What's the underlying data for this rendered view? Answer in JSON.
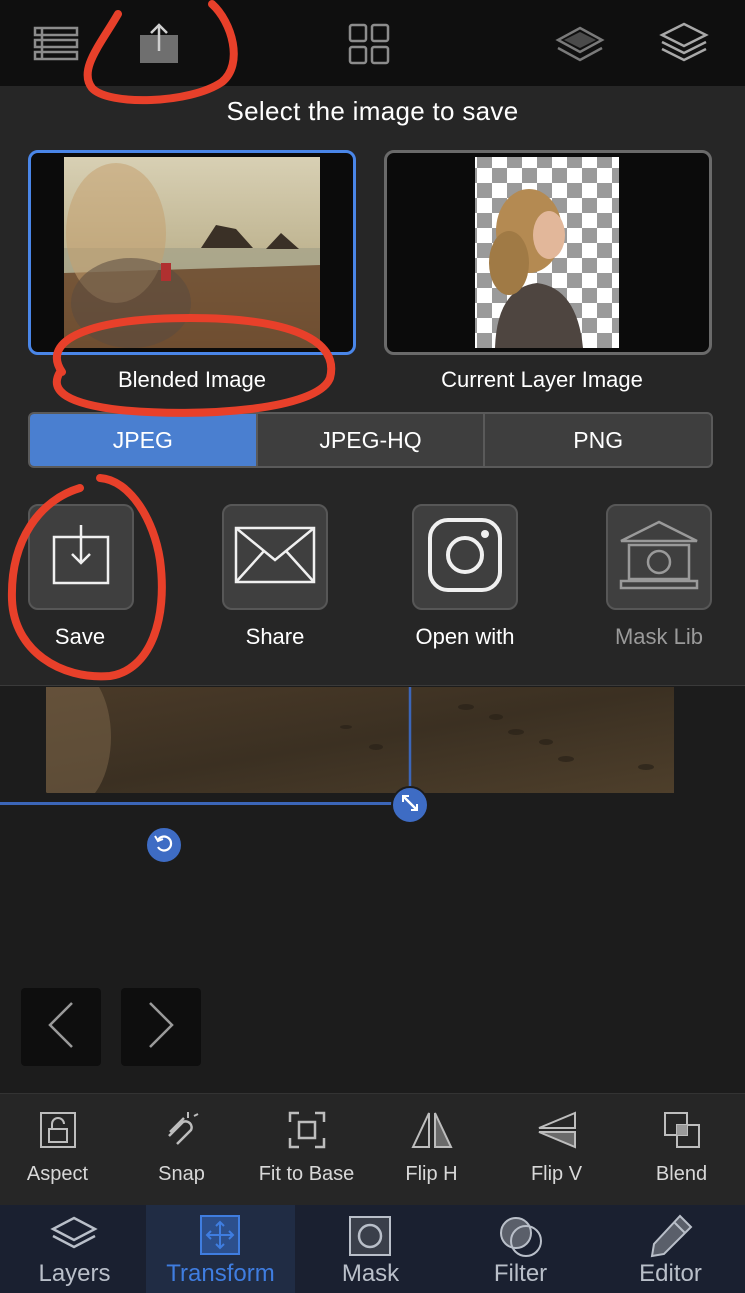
{
  "toolbar": {
    "icons": [
      "list-icon",
      "export-icon",
      "grid-icon",
      "layer-single-icon",
      "layers-stack-icon"
    ]
  },
  "save_panel": {
    "title": "Select the image to save",
    "options": [
      {
        "label": "Blended Image",
        "selected": true
      },
      {
        "label": "Current Layer Image",
        "selected": false
      }
    ],
    "formats": [
      {
        "label": "JPEG",
        "active": true
      },
      {
        "label": "JPEG-HQ",
        "active": false
      },
      {
        "label": "PNG",
        "active": false
      }
    ],
    "actions": [
      {
        "label": "Save",
        "icon": "save-download-icon",
        "enabled": true
      },
      {
        "label": "Share",
        "icon": "envelope-icon",
        "enabled": true
      },
      {
        "label": "Open with",
        "icon": "instagram-icon",
        "enabled": true
      },
      {
        "label": "Mask Lib",
        "icon": "mask-library-icon",
        "enabled": false
      }
    ]
  },
  "tools": [
    {
      "label": "Aspect",
      "icon": "aspect-lock-icon"
    },
    {
      "label": "Snap",
      "icon": "magnet-icon"
    },
    {
      "label": "Fit to Base",
      "icon": "fit-frame-icon"
    },
    {
      "label": "Flip H",
      "icon": "flip-horizontal-icon"
    },
    {
      "label": "Flip V",
      "icon": "flip-vertical-icon"
    },
    {
      "label": "Blend",
      "icon": "blend-squares-icon"
    }
  ],
  "tabs": [
    {
      "label": "Layers",
      "icon": "layers-icon",
      "active": false
    },
    {
      "label": "Transform",
      "icon": "transform-icon",
      "active": true
    },
    {
      "label": "Mask",
      "icon": "mask-icon",
      "active": false
    },
    {
      "label": "Filter",
      "icon": "filter-icon",
      "active": false
    },
    {
      "label": "Editor",
      "icon": "pencil-icon",
      "active": false
    }
  ],
  "colors": {
    "accent": "#4a7fd0",
    "annotation": "#e8402a",
    "background": "#1c1c1c"
  }
}
